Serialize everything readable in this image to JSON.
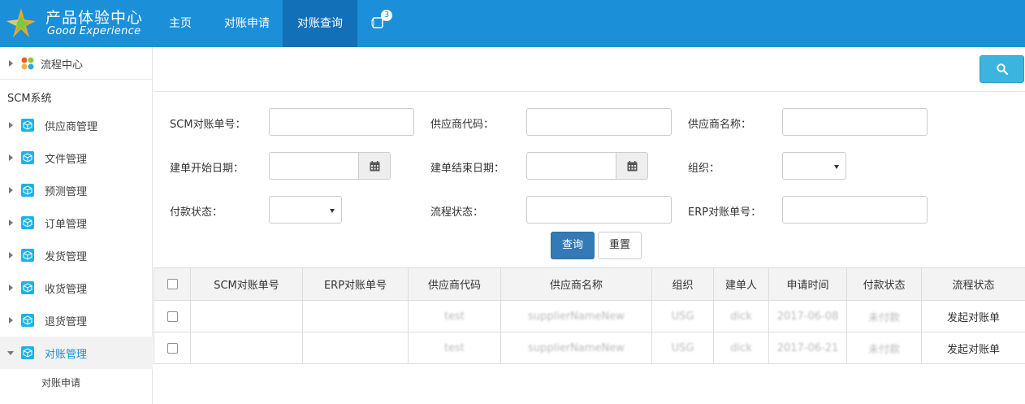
{
  "header": {
    "logo_cn": "产品体验中心",
    "logo_en": "Good Experience",
    "nav": [
      {
        "label": "主页"
      },
      {
        "label": "对账申请"
      },
      {
        "label": "对账查询",
        "active": true
      }
    ],
    "message_badge": "3",
    "bg_color": "#1b8fd8",
    "active_color": "#1170b8"
  },
  "sidebar": {
    "flow_center": "流程中心",
    "system_title": "SCM系统",
    "items": [
      {
        "label": "供应商管理",
        "icon": "box-icon"
      },
      {
        "label": "文件管理",
        "icon": "box-icon"
      },
      {
        "label": "预测管理",
        "icon": "box-icon"
      },
      {
        "label": "订单管理",
        "icon": "box-icon"
      },
      {
        "label": "发货管理",
        "icon": "box-icon"
      },
      {
        "label": "收货管理",
        "icon": "box-icon"
      },
      {
        "label": "退货管理",
        "icon": "box-icon"
      },
      {
        "label": "对账管理",
        "icon": "box-icon",
        "expanded": true
      }
    ],
    "sub_items": [
      {
        "label": "对账申请"
      }
    ]
  },
  "search_form": {
    "scm_no_label": "SCM对账单号：",
    "supplier_code_label": "供应商代码：",
    "supplier_name_label": "供应商名称：",
    "start_date_label": "建单开始日期：",
    "end_date_label": "建单结束日期：",
    "org_label": "组织：",
    "payment_status_label": "付款状态：",
    "flow_status_label": "流程状态：",
    "erp_no_label": "ERP对账单号：",
    "scm_no_value": "",
    "supplier_code_value": "",
    "supplier_name_value": "",
    "start_date_value": "",
    "end_date_value": "",
    "org_value": "",
    "payment_status_value": "",
    "flow_status_value": "",
    "erp_no_value": "",
    "query_button": "查询",
    "reset_button": "重置"
  },
  "table": {
    "columns": [
      "SCM对账单号",
      "ERP对账单号",
      "供应商代码",
      "供应商名称",
      "组织",
      "建单人",
      "申请时间",
      "付款状态",
      "流程状态"
    ],
    "rows": [
      {
        "scm_no": "",
        "erp_no": "",
        "supplier_code": "test",
        "supplier_name": "supplierNameNew",
        "org": "USG",
        "creator": "dick",
        "apply_time": "2017-06-08",
        "payment_status": "未付款",
        "flow_status": "发起对账单"
      },
      {
        "scm_no": "",
        "erp_no": "",
        "supplier_code": "test",
        "supplier_name": "supplierNameNew",
        "org": "USG",
        "creator": "dick",
        "apply_time": "2017-06-21",
        "payment_status": "未付款",
        "flow_status": "发起对账单"
      }
    ]
  }
}
